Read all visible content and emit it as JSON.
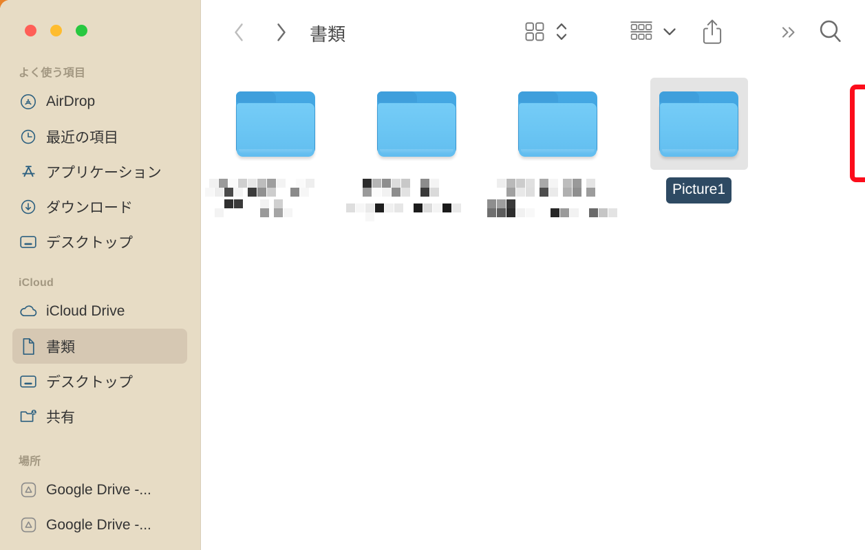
{
  "window": {
    "traffic_lights": [
      {
        "name": "close",
        "color": "#ff5f57"
      },
      {
        "name": "minimize",
        "color": "#febc2e"
      },
      {
        "name": "maximize",
        "color": "#28c840"
      }
    ]
  },
  "sidebar": {
    "sections": [
      {
        "title": "よく使う項目",
        "items": [
          {
            "label": "AirDrop",
            "icon": "airdrop-icon",
            "latin": true,
            "selected": false
          },
          {
            "label": "最近の項目",
            "icon": "clock-icon",
            "latin": false,
            "selected": false
          },
          {
            "label": "アプリケーション",
            "icon": "applications-icon",
            "latin": false,
            "selected": false
          },
          {
            "label": "ダウンロード",
            "icon": "downloads-icon",
            "latin": false,
            "selected": false
          },
          {
            "label": "デスクトップ",
            "icon": "desktop-icon",
            "latin": false,
            "selected": false
          }
        ]
      },
      {
        "title": "iCloud",
        "items": [
          {
            "label": "iCloud Drive",
            "icon": "cloud-icon",
            "latin": true,
            "selected": false
          },
          {
            "label": "書類",
            "icon": "document-icon",
            "latin": false,
            "selected": true
          },
          {
            "label": "デスクトップ",
            "icon": "desktop-icon",
            "latin": false,
            "selected": false
          },
          {
            "label": "共有",
            "icon": "shared-folder-icon",
            "latin": false,
            "selected": false
          }
        ]
      },
      {
        "title": "場所",
        "items": [
          {
            "label": "Google Drive -...",
            "icon": "google-drive-icon",
            "latin": true,
            "selected": false
          },
          {
            "label": "Google Drive -...",
            "icon": "google-drive-icon",
            "latin": true,
            "selected": false
          }
        ]
      }
    ]
  },
  "toolbar": {
    "back_label": "戻る",
    "forward_label": "進む",
    "title": "書類",
    "view_icon_label": "アイコン表示",
    "view_chevrons_label": "表示切り替え",
    "group_label": "グループ",
    "group_chevron_label": "グループメニュー",
    "share_label": "共有",
    "more_label": "その他",
    "search_label": "検索"
  },
  "main": {
    "files": [
      {
        "name": "",
        "redacted": true,
        "selected": false
      },
      {
        "name": "",
        "redacted": true,
        "selected": false
      },
      {
        "name": "",
        "redacted": true,
        "selected": false
      },
      {
        "name": "Picture1",
        "redacted": false,
        "selected": true
      }
    ]
  },
  "annotation": {
    "color": "#fc0d1b",
    "target": "Picture1"
  }
}
